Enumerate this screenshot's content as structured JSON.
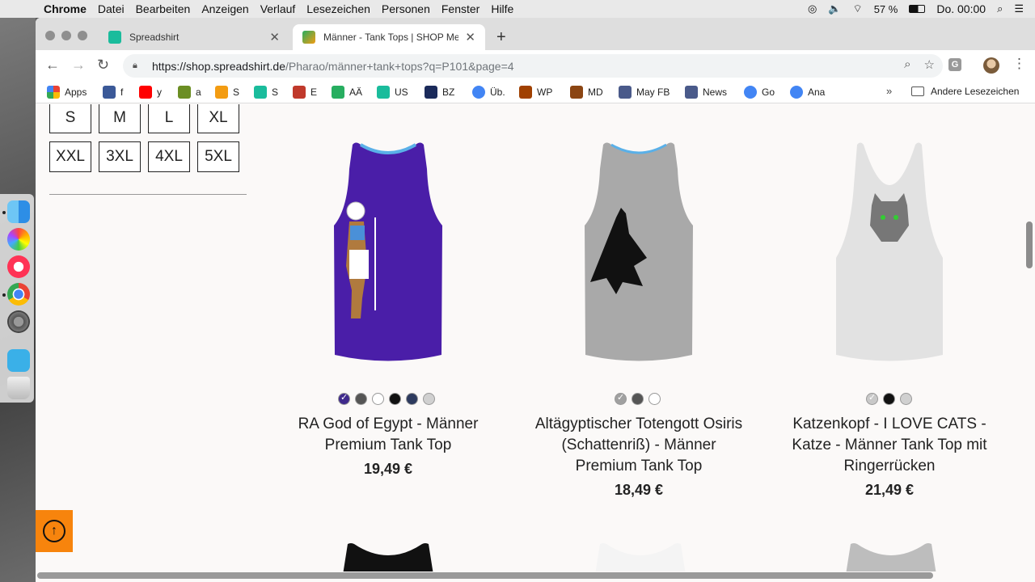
{
  "menubar": {
    "app": "Chrome",
    "items": [
      "Datei",
      "Bearbeiten",
      "Anzeigen",
      "Verlauf",
      "Lesezeichen",
      "Personen",
      "Fenster",
      "Hilfe"
    ],
    "battery": "57 %",
    "clock": "Do. 00:00"
  },
  "tabs": [
    {
      "title": "Spreadshirt"
    },
    {
      "title": "Männer - Tank Tops | SHOP Me"
    }
  ],
  "address": {
    "host": "https://shop.spreadshirt.de",
    "path": "/Pharao/männer+tank+tops?q=P101&page=4"
  },
  "bookmarks": [
    {
      "label": "Apps",
      "color": "#e74c3c"
    },
    {
      "label": "f",
      "color": "#3b5998"
    },
    {
      "label": "y",
      "color": "#ff0000"
    },
    {
      "label": "a",
      "color": "#6b8e23"
    },
    {
      "label": "S",
      "color": "#f39c12"
    },
    {
      "label": "S",
      "color": "#1abc9c"
    },
    {
      "label": "E",
      "color": "#c0392b"
    },
    {
      "label": "AÄ",
      "color": "#27ae60"
    },
    {
      "label": "US",
      "color": "#1abc9c"
    },
    {
      "label": "BZ",
      "color": "#1a2a5a"
    },
    {
      "label": "Üb.",
      "color": "#4285f4"
    },
    {
      "label": "WP",
      "color": "#a04000"
    },
    {
      "label": "MD",
      "color": "#8b4513"
    },
    {
      "label": "May FB",
      "color": "#4a5a8a"
    },
    {
      "label": "News",
      "color": "#4a5a8a"
    },
    {
      "label": "Go",
      "color": "#4285f4"
    },
    {
      "label": "Ana",
      "color": "#4285f4"
    }
  ],
  "bookmarks_other": "Andere Lesezeichen",
  "sizes": [
    "S",
    "M",
    "L",
    "XL",
    "XXL",
    "3XL",
    "4XL",
    "5XL"
  ],
  "products": [
    {
      "title_lines": [
        "RA God of Egypt - Männer",
        "Premium Tank Top"
      ],
      "price": "19,49 €",
      "shirt_color": "#4a1ea8",
      "swatches": [
        "#3f2a8c",
        "#555555",
        "#ffffff",
        "#111111",
        "#2d3a5e",
        "#d0d0d0"
      ],
      "selected": 0
    },
    {
      "title_lines": [
        "Altägyptischer Totengott Osiris",
        "(Schattenriß) - Männer",
        "Premium Tank Top"
      ],
      "price": "18,49 €",
      "shirt_color": "#a9a9a9",
      "swatches": [
        "#a0a0a0",
        "#555555",
        "#ffffff"
      ],
      "selected": 0
    },
    {
      "title_lines": [
        "Katzenkopf - I LOVE CATS -",
        "Katze - Männer Tank Top mit",
        "Ringerrücken"
      ],
      "price": "21,49 €",
      "shirt_color": "#e2e2e2",
      "swatches": [
        "#c8c8c8",
        "#111111",
        "#d0d0d0"
      ],
      "selected": 0
    }
  ]
}
